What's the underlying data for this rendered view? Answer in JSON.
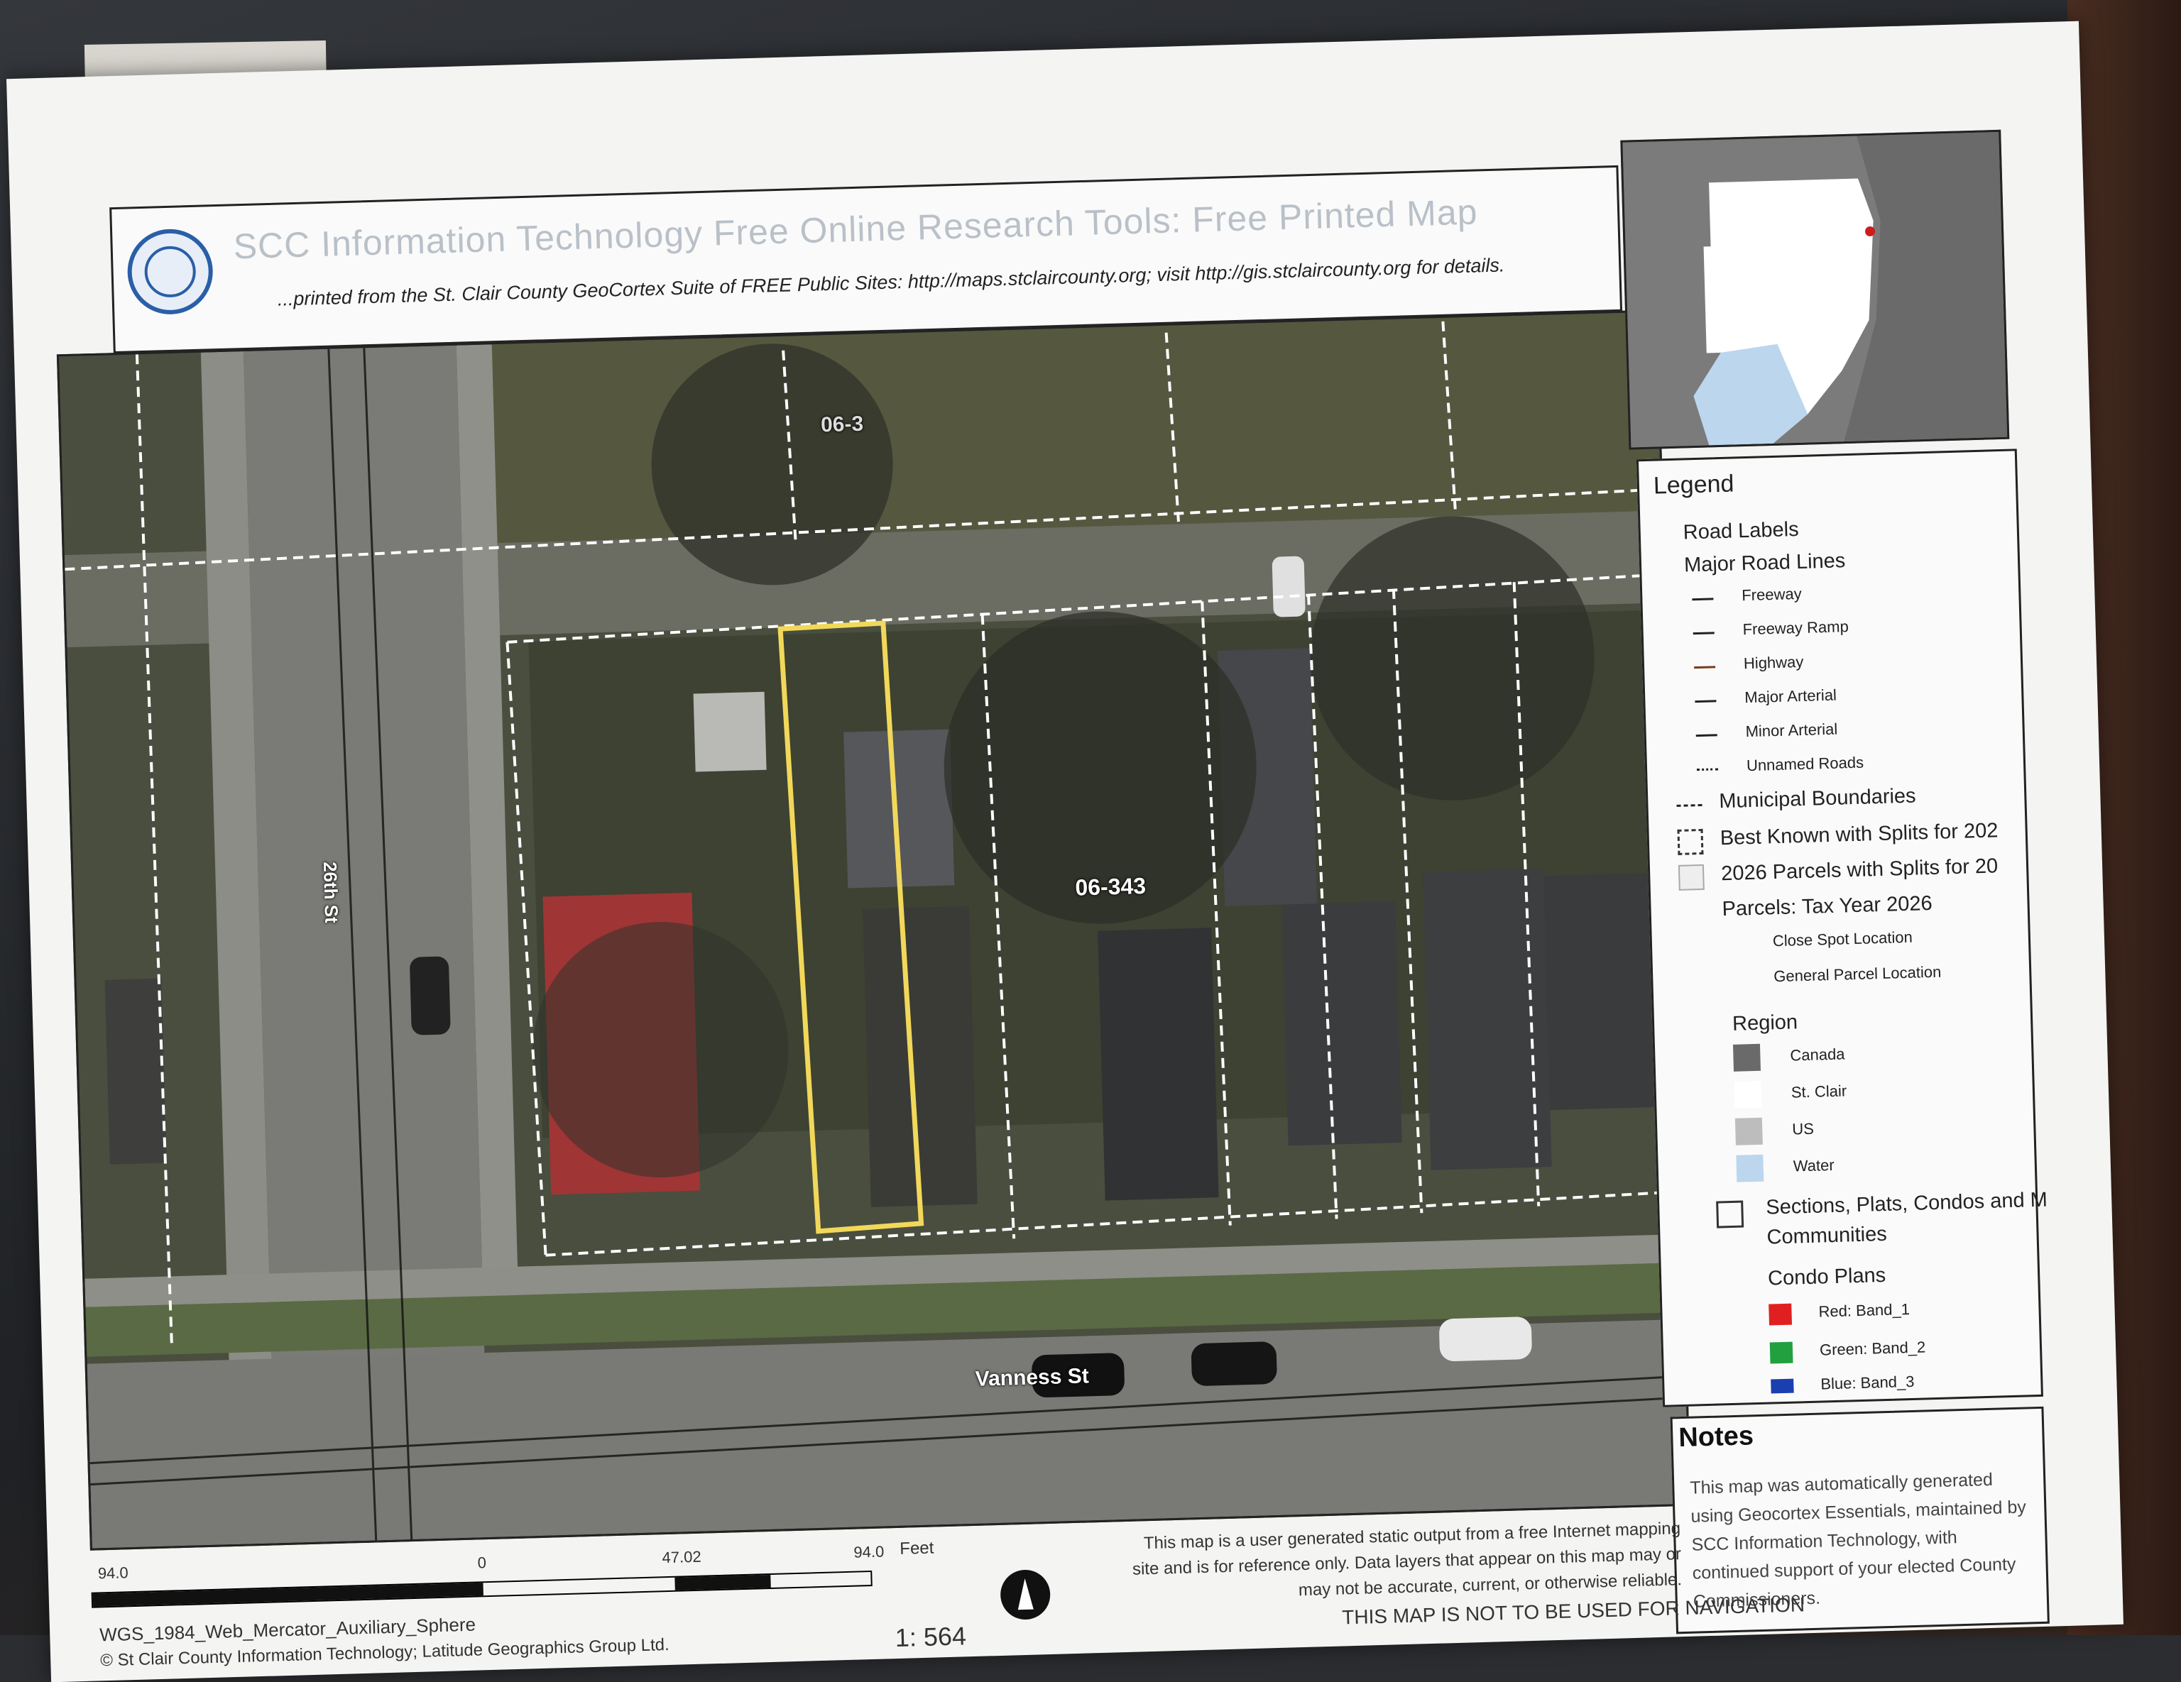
{
  "header": {
    "title": "SCC Information Technology Free Online Research Tools: Free Printed Map",
    "subtitle": "...printed from the St. Clair County GeoCortex Suite of FREE Public Sites: http://maps.stclaircounty.org; visit http://gis.stclaircounty.org for details."
  },
  "map_labels": {
    "street_west": "26th St",
    "street_south": "Vanness St",
    "parcel_number": "06-343",
    "parcel_north": "06-3"
  },
  "legend": {
    "title": "Legend",
    "road_labels": "Road Labels",
    "major_road_lines": "Major Road Lines",
    "road_items": [
      "Freeway",
      "Freeway Ramp",
      "Highway",
      "Major Arterial",
      "Minor Arterial",
      "Unnamed Roads"
    ],
    "road_colors": [
      "#222222",
      "#222222",
      "#7a3b1a",
      "#222222",
      "#222222",
      "#222222"
    ],
    "municipal": "Municipal Boundaries",
    "best_known": "Best Known with Splits for 202",
    "parcels_2026": "2026 Parcels with Splits for 20",
    "parcels_tax": "Parcels: Tax Year 2026",
    "close_spot": "Close Spot Location",
    "general_parcel": "General Parcel Location",
    "region": "Region",
    "region_items": [
      "Canada",
      "St. Clair",
      "US",
      "Water"
    ],
    "region_colors": [
      "#6a6a6a",
      "#ffffff",
      "#bdbdbd",
      "#bcd6ee"
    ],
    "sections": "Sections, Plats, Condos and M",
    "communities": "Communities",
    "condo_plans": "Condo Plans",
    "condo_items": [
      "Red:  Band_1",
      "Green:  Band_2",
      "Blue:  Band_3"
    ],
    "condo_colors": [
      "#e02020",
      "#22a040",
      "#1a3fb0"
    ]
  },
  "notes": {
    "title": "Notes",
    "text": "This map was automatically generated using Geocortex Essentials, maintained by SCC Information Technology, with continued support of your elected County Commissioners."
  },
  "footer": {
    "scale_left": "94.0",
    "scale_zero": "0",
    "scale_mid": "47.02",
    "scale_right": "94.0",
    "scale_unit": "Feet",
    "projection": "WGS_1984_Web_Mercator_Auxiliary_Sphere",
    "copyright": "© St Clair County Information Technology; Latitude Geographics Group Ltd.",
    "ratio": "1: 564",
    "disclaimer": "This map is a user generated static output from a free Internet mapping site and is for reference only. Data layers that appear on this map may or may not be accurate, current, or otherwise reliable.",
    "warning": "THIS MAP IS NOT TO BE USED FOR NAVIGATION"
  }
}
